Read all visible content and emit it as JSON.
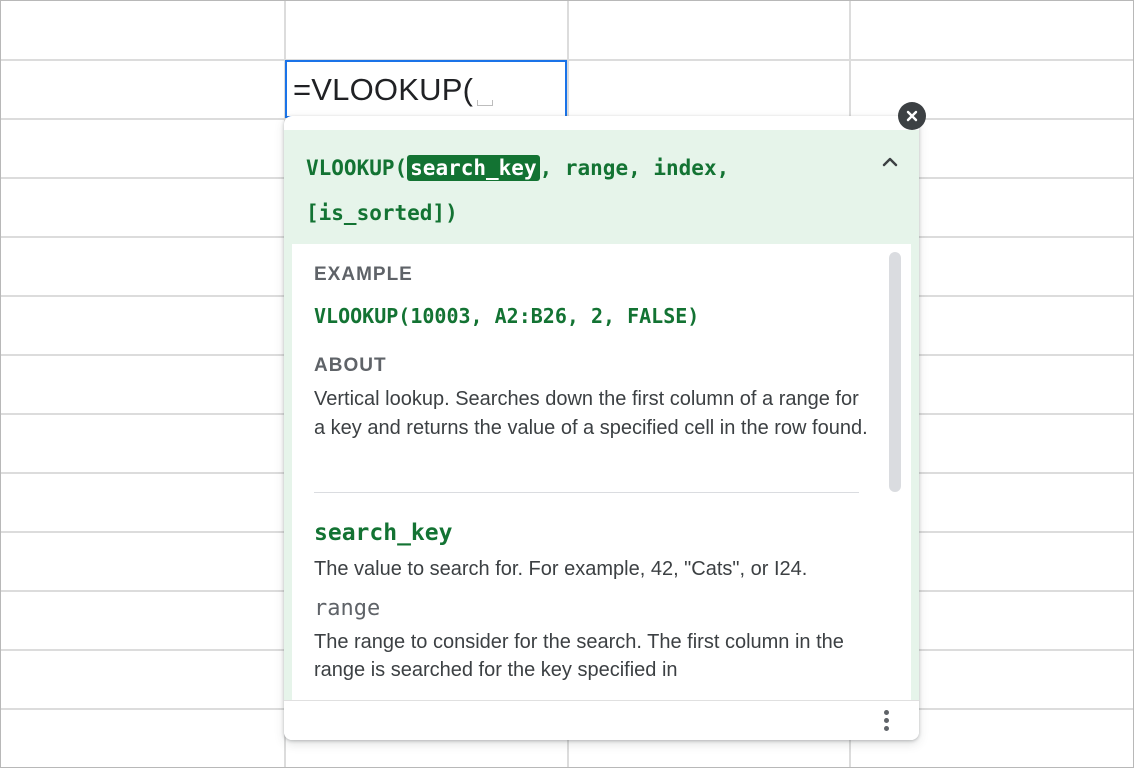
{
  "cell_editor": {
    "formula": "=VLOOKUP("
  },
  "formula_help": {
    "signature": {
      "function_name": "VLOOKUP(",
      "active_param": "search_key",
      "rest_line1": ", range, index,",
      "rest_line2": "[is_sorted])"
    },
    "example": {
      "label": "EXAMPLE",
      "code": "VLOOKUP(10003, A2:B26, 2, FALSE)"
    },
    "about": {
      "label": "ABOUT",
      "text": "Vertical lookup. Searches down the first column of a range for a key and returns the value of a specified cell in the row found."
    },
    "params": [
      {
        "name": "search_key",
        "description": "The value to search for. For example, 42, \"Cats\", or I24."
      },
      {
        "name": "range",
        "description": "The range to consider for the search. The first column in the range is searched for the key specified in"
      }
    ]
  },
  "icons": {
    "close": "close-icon",
    "collapse": "chevron-up-icon",
    "more": "more-vert-icon"
  },
  "colors": {
    "accent_green": "#137333",
    "help_background": "#e6f4ea",
    "cell_border": "#1a73e8"
  }
}
